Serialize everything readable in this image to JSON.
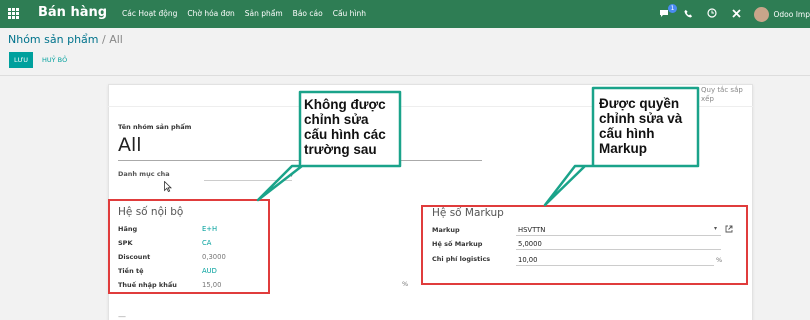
{
  "navbar": {
    "brand": "Bán hàng",
    "menu": [
      "Các Hoạt động",
      "Chờ hóa đơn",
      "Sản phẩm",
      "Báo cáo",
      "Cấu hình"
    ],
    "chat_badge": "1",
    "user": "Odoo Imp",
    "icons": [
      "apps-grid-icon",
      "chat-icon",
      "phone-icon",
      "clock-icon",
      "close-icon"
    ]
  },
  "breadcrumb": {
    "parent": "Nhóm sản phẩm",
    "separator": "/",
    "current": "All"
  },
  "actions": {
    "save": "LƯU",
    "discard": "HUỶ BỎ"
  },
  "side_link": "Quy tắc sắp xếp",
  "form": {
    "name_label": "Tên nhóm sản phẩm",
    "name_value": "All",
    "parent_label": "Danh mục cha"
  },
  "internal": {
    "title": "Hệ số nội bộ",
    "fields": [
      {
        "label": "Hãng",
        "value": "E+H"
      },
      {
        "label": "SPK",
        "value": "CA"
      },
      {
        "label": "Discount",
        "value": "0,3000"
      },
      {
        "label": "Tiền tệ",
        "value": "AUD"
      },
      {
        "label": "Thuế nhập khẩu",
        "value": "15,00"
      }
    ],
    "percent": "%"
  },
  "markup": {
    "title": "Hệ số Markup",
    "fields": [
      {
        "label": "Markup",
        "value": "HSVTTN"
      },
      {
        "label": "Hệ số Markup",
        "value": "5,0000"
      },
      {
        "label": "Chi phí logistics",
        "value": "10,00"
      }
    ],
    "percent": "%"
  },
  "callouts": {
    "left": [
      "Không được",
      "chỉnh sửa",
      "cấu hình các",
      "trường sau"
    ],
    "right": [
      "Được quyền",
      "chỉnh sửa và",
      "cấu hình",
      "Markup"
    ]
  },
  "colors": {
    "navbar": "#2e7d54",
    "accent": "#00a09d",
    "highlight": "#e03c3c",
    "callout_border": "#1aa38a"
  }
}
